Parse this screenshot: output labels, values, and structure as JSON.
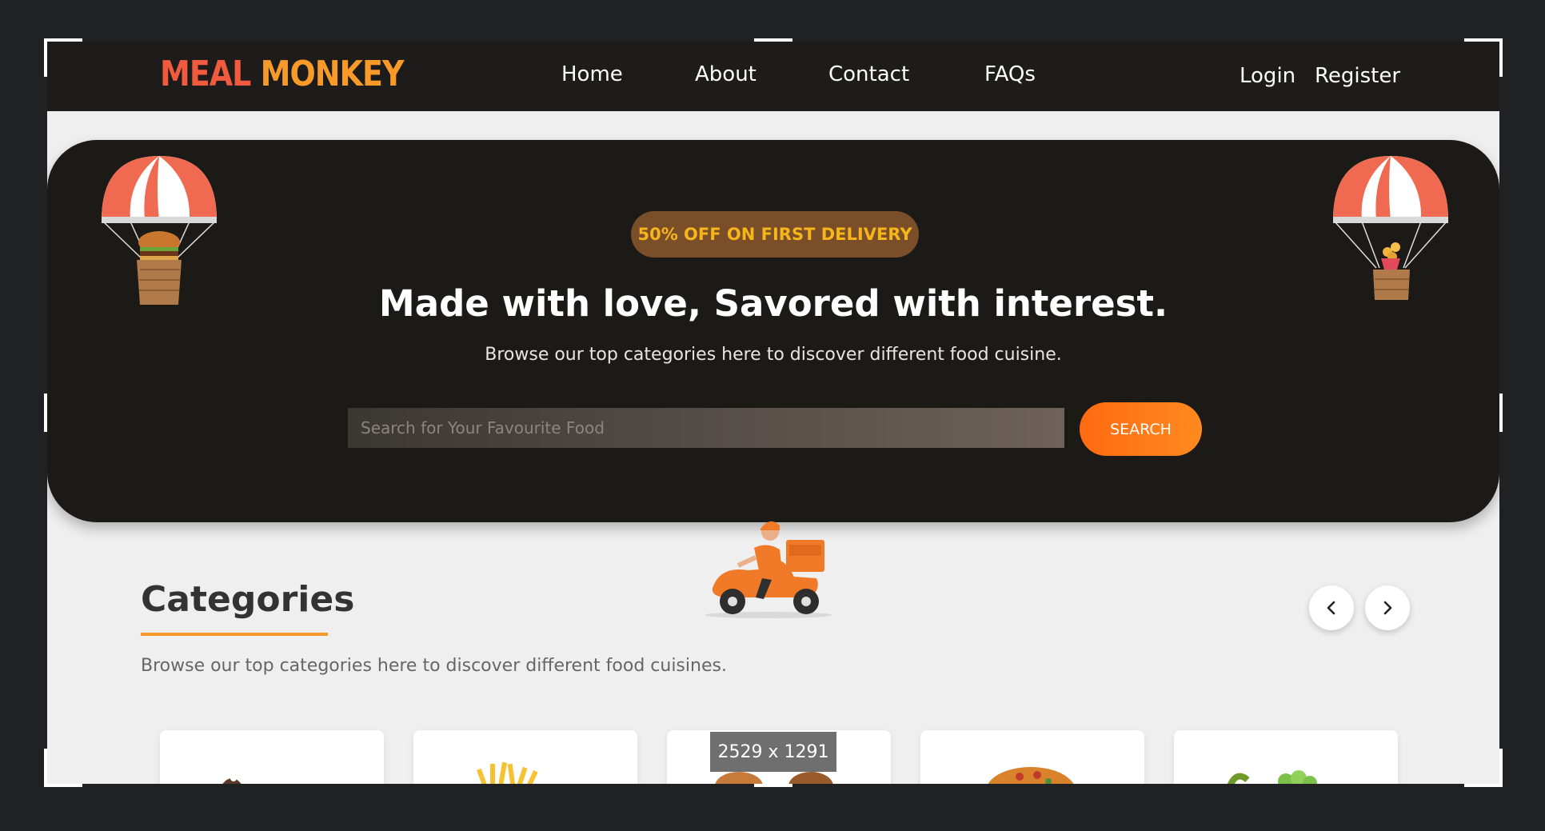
{
  "brand": {
    "logo_part1": "MEAL ",
    "logo_part2": "MONKEY"
  },
  "nav": {
    "links": [
      "Home",
      "About",
      "Contact",
      "FAQs"
    ],
    "login": "Login",
    "register": "Register"
  },
  "hero": {
    "promo": "50% OFF ON FIRST DELIVERY",
    "title": "Made with love, Savored with interest.",
    "subtitle": "Browse our top categories here to discover different food cuisine.",
    "search_placeholder": "Search for Your Favourite Food",
    "search_button": "SEARCH"
  },
  "categories": {
    "title": "Categories",
    "subtitle": "Browse our top categories here to discover different food cuisines.",
    "prev_icon": "chevron-left-icon",
    "next_icon": "chevron-right-icon",
    "cards": [
      "dessert",
      "fries",
      "burger",
      "pizza",
      "salad"
    ]
  },
  "overlay": {
    "dimensions": "2529 x 1291"
  },
  "colors": {
    "accent": "#ff6a10",
    "brand_red": "#f05a3f",
    "brand_orange": "#f79a2a",
    "promo_text": "#f7b51c",
    "dark": "#1c1a17"
  }
}
